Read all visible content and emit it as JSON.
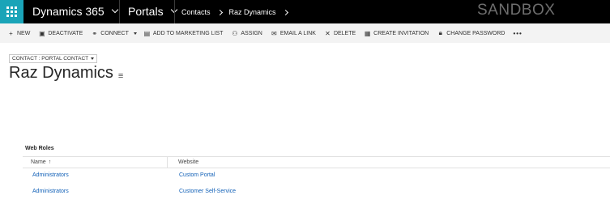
{
  "topbar": {
    "app_name": "Dynamics 365",
    "area": "Portals",
    "breadcrumbs": [
      "Contacts",
      "Raz Dynamics"
    ],
    "environment": "SANDBOX",
    "brand_color": "#1aa4b8"
  },
  "commands": [
    {
      "icon": "plus-icon",
      "glyph": "+",
      "label": "NEW"
    },
    {
      "icon": "deactivate-icon",
      "glyph": "▣",
      "label": "DEACTIVATE"
    },
    {
      "icon": "connect-icon",
      "glyph": "⚭",
      "label": "CONNECT"
    },
    {
      "icon": "marketing-list-icon",
      "glyph": "▤",
      "label": "ADD TO MARKETING LIST"
    },
    {
      "icon": "assign-icon",
      "glyph": "⚇",
      "label": "ASSIGN"
    },
    {
      "icon": "email-icon",
      "glyph": "✉",
      "label": "EMAIL A LINK"
    },
    {
      "icon": "delete-icon",
      "glyph": "✕",
      "label": "DELETE"
    },
    {
      "icon": "invitation-icon",
      "glyph": "▦",
      "label": "CREATE INVITATION"
    },
    {
      "icon": "lock-icon",
      "glyph": "🔒︎",
      "label": "CHANGE PASSWORD"
    }
  ],
  "more_glyph": "•••",
  "form": {
    "selector_label": "CONTACT : PORTAL CONTACT",
    "record_title": "Raz Dynamics"
  },
  "web_roles": {
    "title": "Web Roles",
    "columns": [
      "Name",
      "Website"
    ],
    "sort_glyph": "↑",
    "rows": [
      {
        "name": "Administrators",
        "website": "Custom Portal"
      },
      {
        "name": "Administrators",
        "website": "Customer Self-Service"
      }
    ]
  }
}
